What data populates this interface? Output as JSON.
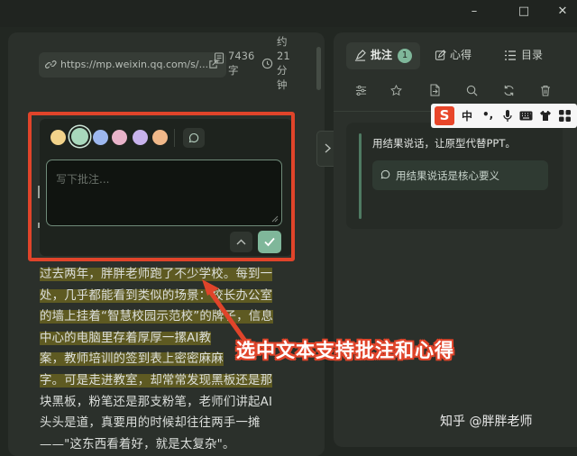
{
  "window": {
    "controls": [
      "–",
      "□",
      "✕"
    ]
  },
  "article": {
    "url": "https://mp.weixin.qq.com/s/...",
    "word_count_lines": [
      "7436",
      "字"
    ],
    "read_time_lines": [
      "约",
      "21",
      "分",
      "钟"
    ],
    "body_lines": [
      "过去两年，胖胖老师跑了不少学校。每到一",
      "处，几乎都能看到类似的场景：校长办公室",
      "的墙上挂着“智慧校园示范校”的牌子，信息",
      "中心的电脑里存着厚厚一摞AI教",
      "案，教师培训的签到表上密密麻麻",
      "字。可是走进教室，却常常发现黑板还是那",
      "块黑板，粉笔还是那支粉笔，老师们讲起AI",
      "头头是道，真要用的时候却往往两手一摊",
      "——\"这东西看着好，就是太复杂\"。"
    ]
  },
  "annotation_popup": {
    "colors": [
      "#f2d38a",
      "#a8d8bc",
      "#9db8ef",
      "#e8b3c9",
      "#c8b3ec",
      "#f0b889"
    ],
    "placeholder": "写下批注...",
    "up_icon": "chevron-up-icon",
    "confirm_icon": "check-icon"
  },
  "right_panel": {
    "tabs": [
      {
        "label": "批注",
        "badge": "1",
        "icon": "highlight-icon"
      },
      {
        "label": "心得",
        "icon": "edit-note-icon"
      },
      {
        "label": "目录",
        "icon": "list-icon"
      }
    ],
    "toolbar_icons": [
      "filter-icon",
      "star-icon",
      "export-icon",
      "search-icon",
      "refresh-icon",
      "trash-icon"
    ],
    "annotation": {
      "quote": "用结果说话，让原型代替PPT。",
      "comment": "用结果说话是核心要义"
    }
  },
  "ime_bar": {
    "items": [
      "中",
      "•,"
    ]
  },
  "overlay": {
    "callout": "选中文本支持批注和心得",
    "watermark": "知乎 @胖胖老师"
  },
  "colors": {
    "accent": "#7fb79a",
    "highlight": "#5e5a22",
    "callout_red": "#e0442a"
  }
}
